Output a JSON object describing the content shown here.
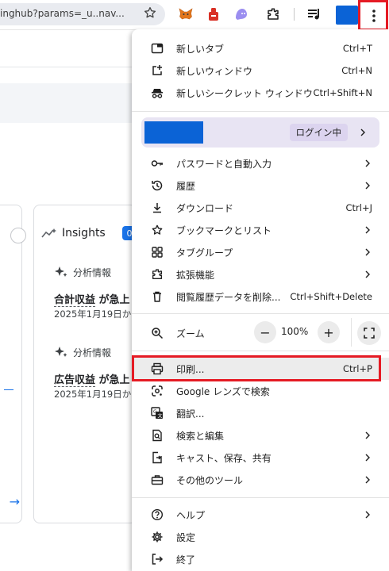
{
  "toolbar": {
    "url_fragment": "inghub?params=_u..nav...",
    "icons": [
      "bookmark-star-icon",
      "metamask-extension-icon",
      "red-extension-icon",
      "ghost-extension-icon",
      "extensions-puzzle-icon",
      "media-controls-icon",
      "profile-avatar",
      "chrome-menu-icon"
    ],
    "accent": "#0b63d6",
    "highlight_color": "#e51b24"
  },
  "page": {
    "insights_title": "Insights",
    "insights_badge": "0",
    "items": [
      {
        "label": "分析情報",
        "headline_ul": "合計収益",
        "headline_rest": " が急上",
        "date": "2025年1月19日か"
      },
      {
        "label": "分析情報",
        "headline_ul": "広告収益",
        "headline_rest": " が急上",
        "date": "2025年1月19日か"
      }
    ]
  },
  "menu": {
    "new_tab": {
      "label": "新しいタブ",
      "shortcut": "Ctrl+T"
    },
    "new_window": {
      "label": "新しいウィンドウ",
      "shortcut": "Ctrl+N"
    },
    "incognito": {
      "label": "新しいシークレット ウィンドウ",
      "shortcut": "Ctrl+Shift+N"
    },
    "profile": {
      "status": "ログイン中"
    },
    "passwords": {
      "label": "パスワードと自動入力"
    },
    "history": {
      "label": "履歴"
    },
    "downloads": {
      "label": "ダウンロード",
      "shortcut": "Ctrl+J"
    },
    "bookmarks": {
      "label": "ブックマークとリスト"
    },
    "tab_groups": {
      "label": "タブグループ"
    },
    "extensions": {
      "label": "拡張機能"
    },
    "clear_data": {
      "label": "閲覧履歴データを削除...",
      "shortcut": "Ctrl+Shift+Delete"
    },
    "zoom": {
      "label": "ズーム",
      "minus": "−",
      "value": "100%",
      "plus": "+"
    },
    "print": {
      "label": "印刷...",
      "shortcut": "Ctrl+P"
    },
    "lens": {
      "label": "Google レンズで検索"
    },
    "translate": {
      "label": "翻訳..."
    },
    "find_edit": {
      "label": "検索と編集"
    },
    "cast": {
      "label": "キャスト、保存、共有"
    },
    "more_tools": {
      "label": "その他のツール"
    },
    "help": {
      "label": "ヘルプ"
    },
    "settings": {
      "label": "設定"
    },
    "exit": {
      "label": "終了"
    }
  }
}
